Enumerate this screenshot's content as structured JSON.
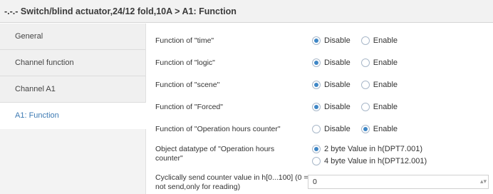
{
  "title": "-.-.- Switch/blind actuator,24/12 fold,10A > A1: Function",
  "sidebar": {
    "items": [
      {
        "label": "General",
        "active": false
      },
      {
        "label": "Channel function",
        "active": false
      },
      {
        "label": "Channel A1",
        "active": false
      },
      {
        "label": "A1: Function",
        "active": true
      }
    ]
  },
  "params": [
    {
      "label": "Function of \"time\"",
      "options": [
        "Disable",
        "Enable"
      ],
      "selected": 0
    },
    {
      "label": "Function of \"logic\"",
      "options": [
        "Disable",
        "Enable"
      ],
      "selected": 0
    },
    {
      "label": "Function of \"scene\"",
      "options": [
        "Disable",
        "Enable"
      ],
      "selected": 0
    },
    {
      "label": "Function of \"Forced\"",
      "options": [
        "Disable",
        "Enable"
      ],
      "selected": 0
    },
    {
      "label": "Function of \"Operation hours counter\"",
      "options": [
        "Disable",
        "Enable"
      ],
      "selected": 1
    },
    {
      "label": "Object datatype of \"Operation hours counter\"",
      "options": [
        "2 byte Value in h(DPT7.001)",
        "4 byte Value in h(DPT12.001)"
      ],
      "selected": 0
    },
    {
      "label": "Cyclically send counter value in h[0...100] (0 = not send,only for reading)",
      "value": "0"
    }
  ],
  "colors": {
    "accent": "#3f87c6",
    "active_text": "#3d7ab3"
  }
}
